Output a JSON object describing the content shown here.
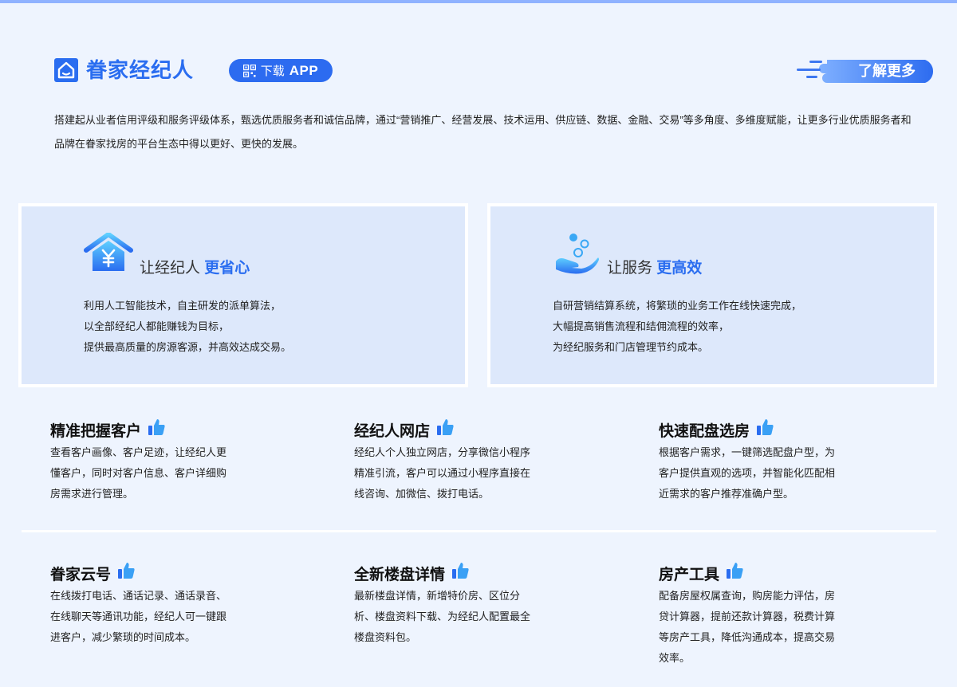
{
  "header": {
    "brand_name": "眷家经纪人",
    "download_label": "下载",
    "download_app": "APP",
    "learn_more": "了解更多"
  },
  "intro": "搭建起从业者信用评级和服务评级体系，甄选优质服务者和诚信品牌，通过“营销推广、经营发展、技术运用、供应链、数据、金融、交易”等多角度、多维度赋能，让更多行业优质服务者和品牌在眷家找房的平台生态中得以更好、更快的发展。",
  "cards": [
    {
      "title_prefix": "让经纪人 ",
      "title_highlight": "更省心",
      "lines": [
        "利用人工智能技术，自主研发的派单算法，",
        "以全部经纪人都能赚钱为目标，",
        "提供最高质量的房源客源，并高效达成交易。"
      ]
    },
    {
      "title_prefix": "让服务 ",
      "title_highlight": "更高效",
      "lines": [
        "自研营销结算系统，将繁琐的业务工作在线快速完成，",
        "大幅提高销售流程和结佣流程的效率，",
        "为经纪服务和门店管理节约成本。"
      ]
    }
  ],
  "features": [
    {
      "title": "精准把握客户",
      "desc": "查看客户画像、客户足迹，让经纪人更懂客户，同时对客户信息、客户详细购房需求进行管理。"
    },
    {
      "title": "经纪人网店",
      "desc": "经纪人个人独立网店，分享微信小程序精准引流，客户可以通过小程序直接在线咨询、加微信、拨打电话。"
    },
    {
      "title": "快速配盘选房",
      "desc": "根据客户需求，一键筛选配盘户型，为客户提供直观的选项，并智能化匹配相近需求的客户推荐准确户型。"
    },
    {
      "title": "眷家云号",
      "desc": "在线拨打电话、通话记录、通话录音、在线聊天等通讯功能，经纪人可一键跟进客户，减少繁琐的时间成本。"
    },
    {
      "title": "全新楼盘详情",
      "desc": "最新楼盘详情，新增特价房、区位分析、楼盘资料下载、为经纪人配置最全楼盘资料包。"
    },
    {
      "title": "房产工具",
      "desc": "配备房屋权属查询，购房能力评估，房贷计算器，提前还款计算器，税费计算等房产工具，降低沟通成本，提高交易效率。"
    }
  ],
  "colors": {
    "accent": "#2a6df0",
    "background": "#eef4fe",
    "card": "#dde8fb"
  },
  "icons": [
    "home-logo-icon",
    "qr-code-icon",
    "house-yen-icon",
    "hand-bubbles-icon",
    "thumbs-up-icon"
  ]
}
